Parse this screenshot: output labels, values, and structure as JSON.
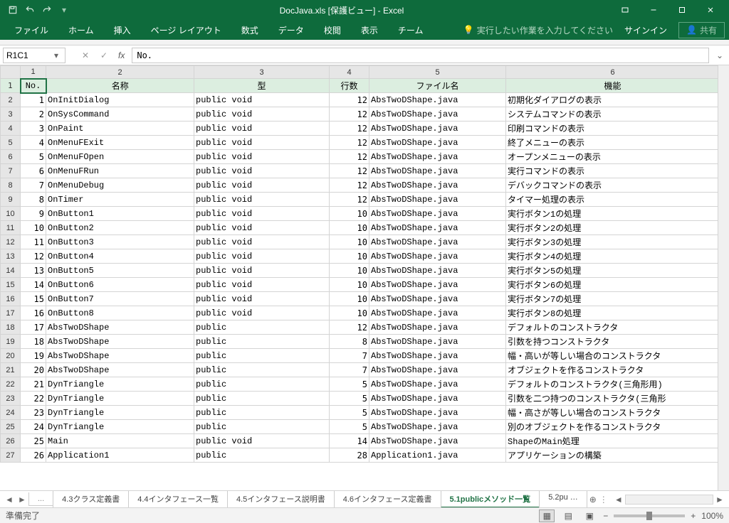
{
  "title": "DocJava.xls  [保護ビュー] - Excel",
  "qat": {
    "save": "save",
    "undo": "undo",
    "redo": "redo"
  },
  "winControls": {
    "signin": "サインイン",
    "share": "共有"
  },
  "ribbonTabs": [
    "ファイル",
    "ホーム",
    "挿入",
    "ページ レイアウト",
    "数式",
    "データ",
    "校閲",
    "表示",
    "チーム"
  ],
  "tellMe": "実行したい作業を入力してください",
  "nameBox": "R1C1",
  "formula": "No.",
  "colHeaders": [
    "1",
    "2",
    "3",
    "4",
    "5",
    "6"
  ],
  "sheetHeaders": [
    "No.",
    "名称",
    "型",
    "行数",
    "ファイル名",
    "機能"
  ],
  "rows": [
    {
      "r": "2",
      "no": "1",
      "name": "OnInitDialog",
      "type": "public void",
      "lines": "12",
      "file": "AbsTwoDShape.java",
      "func": "初期化ダイアログの表示"
    },
    {
      "r": "3",
      "no": "2",
      "name": "OnSysCommand",
      "type": "public void",
      "lines": "12",
      "file": "AbsTwoDShape.java",
      "func": "システムコマンドの表示"
    },
    {
      "r": "4",
      "no": "3",
      "name": "OnPaint",
      "type": "public void",
      "lines": "12",
      "file": "AbsTwoDShape.java",
      "func": "印刷コマンドの表示"
    },
    {
      "r": "5",
      "no": "4",
      "name": "OnMenuFExit",
      "type": "public void",
      "lines": "12",
      "file": "AbsTwoDShape.java",
      "func": "終了メニューの表示"
    },
    {
      "r": "6",
      "no": "5",
      "name": "OnMenuFOpen",
      "type": "public void",
      "lines": "12",
      "file": "AbsTwoDShape.java",
      "func": "オープンメニューの表示"
    },
    {
      "r": "7",
      "no": "6",
      "name": "OnMenuFRun",
      "type": "public void",
      "lines": "12",
      "file": "AbsTwoDShape.java",
      "func": "実行コマンドの表示"
    },
    {
      "r": "8",
      "no": "7",
      "name": "OnMenuDebug",
      "type": "public void",
      "lines": "12",
      "file": "AbsTwoDShape.java",
      "func": "デバックコマンドの表示"
    },
    {
      "r": "9",
      "no": "8",
      "name": "OnTimer",
      "type": "public void",
      "lines": "12",
      "file": "AbsTwoDShape.java",
      "func": "タイマー処理の表示"
    },
    {
      "r": "10",
      "no": "9",
      "name": "OnButton1",
      "type": "public void",
      "lines": "10",
      "file": "AbsTwoDShape.java",
      "func": "実行ボタン1の処理"
    },
    {
      "r": "11",
      "no": "10",
      "name": "OnButton2",
      "type": "public void",
      "lines": "10",
      "file": "AbsTwoDShape.java",
      "func": "実行ボタン2の処理"
    },
    {
      "r": "12",
      "no": "11",
      "name": "OnButton3",
      "type": "public void",
      "lines": "10",
      "file": "AbsTwoDShape.java",
      "func": "実行ボタン3の処理"
    },
    {
      "r": "13",
      "no": "12",
      "name": "OnButton4",
      "type": "public void",
      "lines": "10",
      "file": "AbsTwoDShape.java",
      "func": "実行ボタン4の処理"
    },
    {
      "r": "14",
      "no": "13",
      "name": "OnButton5",
      "type": "public void",
      "lines": "10",
      "file": "AbsTwoDShape.java",
      "func": "実行ボタン5の処理"
    },
    {
      "r": "15",
      "no": "14",
      "name": "OnButton6",
      "type": "public void",
      "lines": "10",
      "file": "AbsTwoDShape.java",
      "func": "実行ボタン6の処理"
    },
    {
      "r": "16",
      "no": "15",
      "name": "OnButton7",
      "type": "public void",
      "lines": "10",
      "file": "AbsTwoDShape.java",
      "func": "実行ボタン7の処理"
    },
    {
      "r": "17",
      "no": "16",
      "name": "OnButton8",
      "type": "public void",
      "lines": "10",
      "file": "AbsTwoDShape.java",
      "func": "実行ボタン8の処理"
    },
    {
      "r": "18",
      "no": "17",
      "name": "AbsTwoDShape",
      "type": "public",
      "lines": "12",
      "file": "AbsTwoDShape.java",
      "func": "デフォルトのコンストラクタ"
    },
    {
      "r": "19",
      "no": "18",
      "name": "AbsTwoDShape",
      "type": "public",
      "lines": "8",
      "file": "AbsTwoDShape.java",
      "func": "引数を持つコンストラクタ"
    },
    {
      "r": "20",
      "no": "19",
      "name": "AbsTwoDShape",
      "type": "public",
      "lines": "7",
      "file": "AbsTwoDShape.java",
      "func": "幅・高いが等しい場合のコンストラクタ"
    },
    {
      "r": "21",
      "no": "20",
      "name": "AbsTwoDShape",
      "type": "public",
      "lines": "7",
      "file": "AbsTwoDShape.java",
      "func": "オブジェクトを作るコンストラクタ"
    },
    {
      "r": "22",
      "no": "21",
      "name": "DynTriangle",
      "type": "public",
      "lines": "5",
      "file": "AbsTwoDShape.java",
      "func": "デフォルトのコンストラクタ(三角形用)"
    },
    {
      "r": "23",
      "no": "22",
      "name": "DynTriangle",
      "type": "public",
      "lines": "5",
      "file": "AbsTwoDShape.java",
      "func": "引数を二つ持つのコンストラクタ(三角形"
    },
    {
      "r": "24",
      "no": "23",
      "name": "DynTriangle",
      "type": "public",
      "lines": "5",
      "file": "AbsTwoDShape.java",
      "func": "幅・高さが等しい場合のコンストラクタ"
    },
    {
      "r": "25",
      "no": "24",
      "name": "DynTriangle",
      "type": "public",
      "lines": "5",
      "file": "AbsTwoDShape.java",
      "func": "別のオブジェクトを作るコンストラクタ"
    },
    {
      "r": "26",
      "no": "25",
      "name": "Main",
      "type": "public void",
      "lines": "14",
      "file": "AbsTwoDShape.java",
      "func": "ShapeのMain処理"
    },
    {
      "r": "27",
      "no": "26",
      "name": "Application1",
      "type": "public",
      "lines": "28",
      "file": "Application1.java",
      "func": "アプリケーションの構築"
    }
  ],
  "sheetTabs": {
    "ellipsis": "...",
    "tabs": [
      "4.3クラス定義書",
      "4.4インタフェース一覧",
      "4.5インタフェース説明書",
      "4.6インタフェース定義書",
      "5.1publicメソッド一覧",
      "5.2pu …"
    ],
    "active": 4
  },
  "status": {
    "ready": "準備完了",
    "zoom": "100%",
    "minus": "−",
    "plus": "+"
  }
}
